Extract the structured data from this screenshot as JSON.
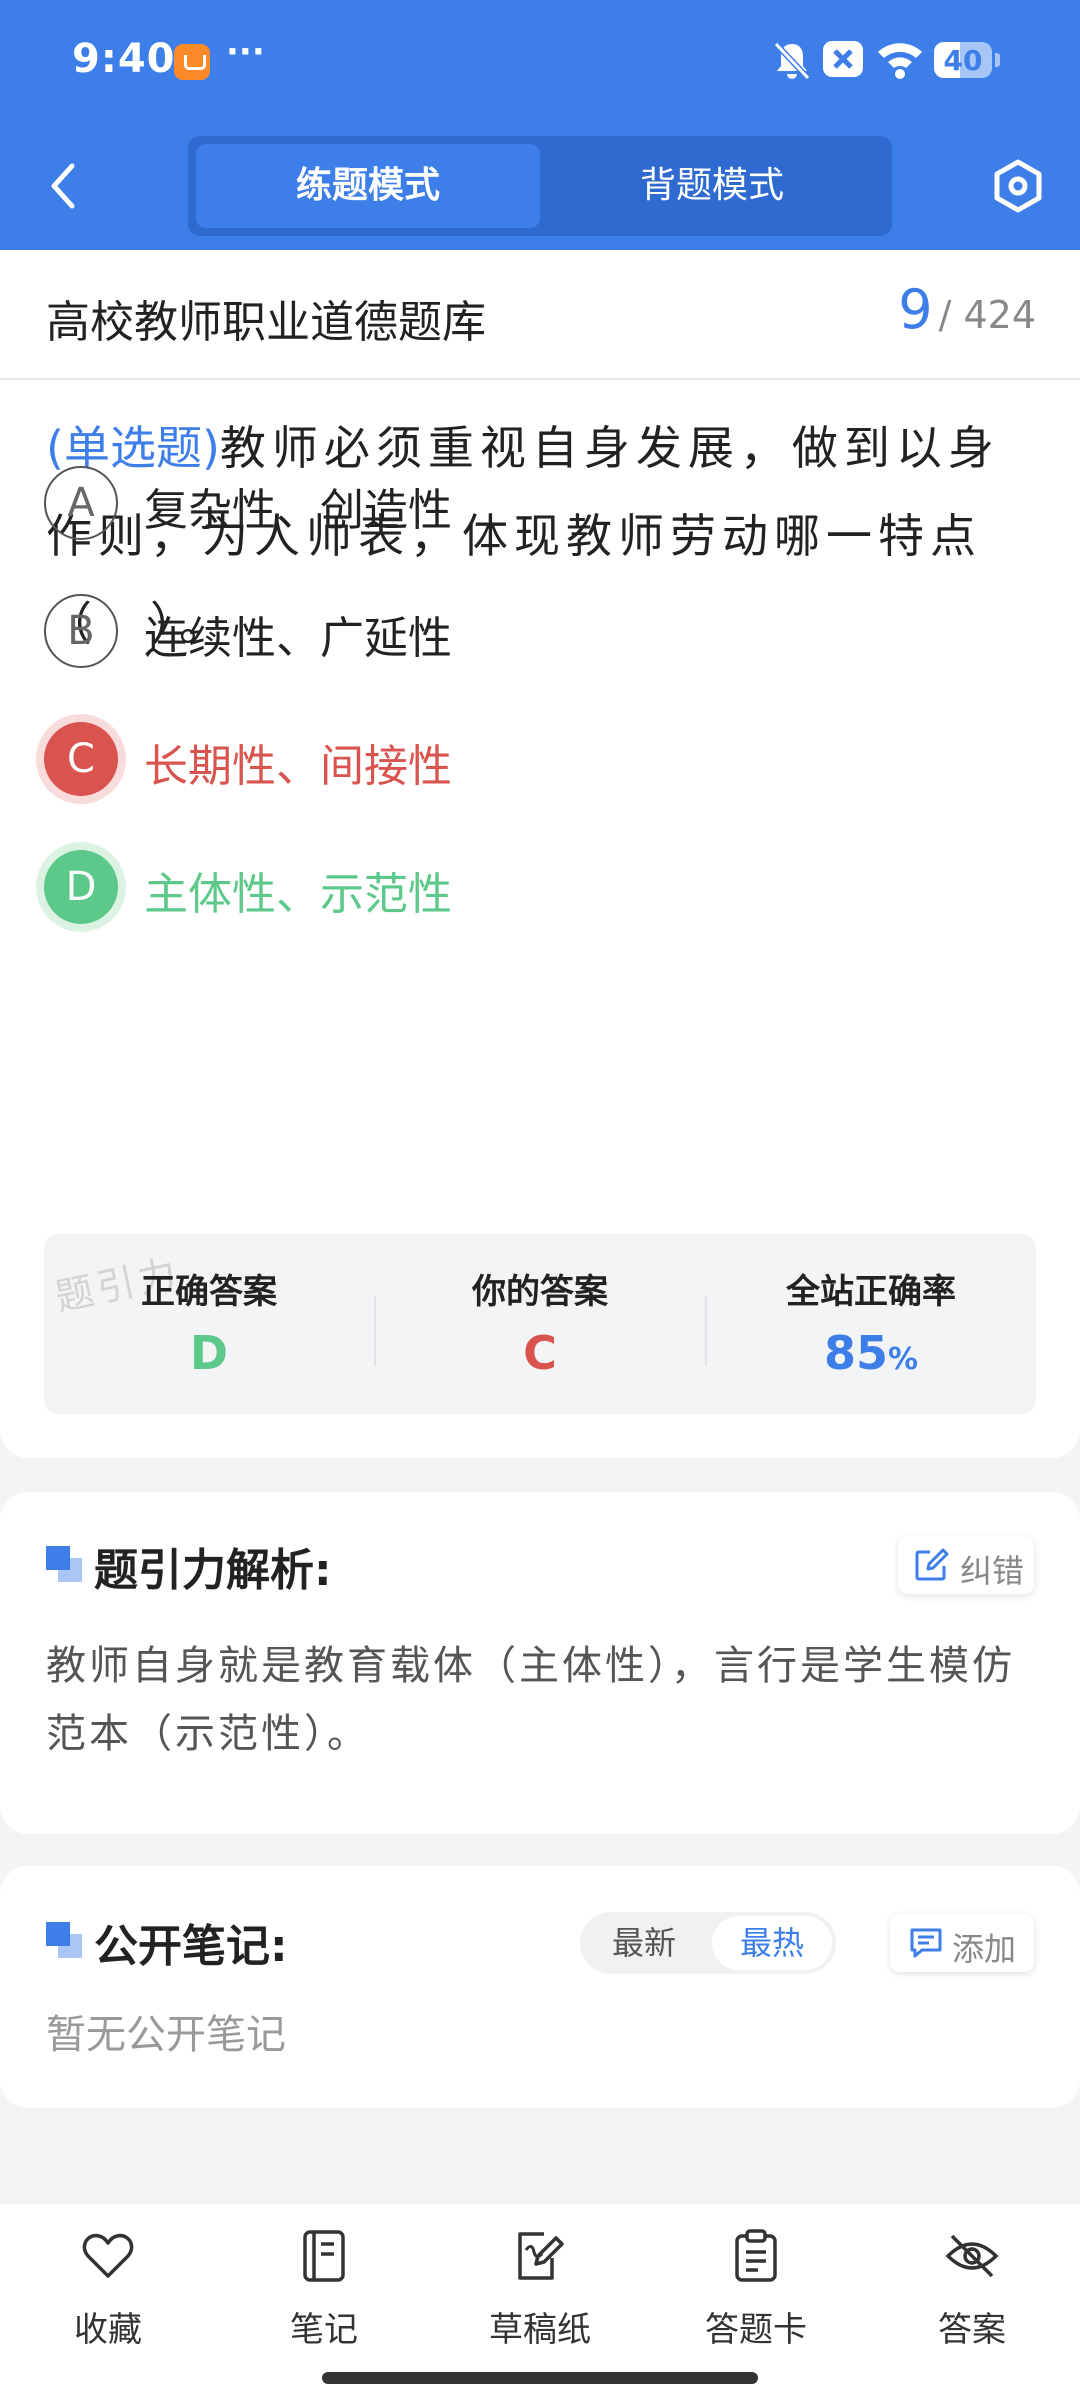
{
  "status_bar": {
    "time": "9:40",
    "more": "···",
    "battery": "40"
  },
  "header": {
    "modes": [
      "练题模式",
      "背题模式"
    ],
    "active_mode": "练题模式"
  },
  "bank": {
    "title": "高校教师职业道德题库",
    "current": "9",
    "total": "/ 424"
  },
  "question": {
    "type": "(单选题)",
    "text": "教师必须重视自身发展，做到以身作则，为人师表，体现教师劳动哪一特点（　）。",
    "options": [
      {
        "letter": "A",
        "text": "复杂性、创造性",
        "state": "normal"
      },
      {
        "letter": "B",
        "text": "连续性、广延性",
        "state": "normal"
      },
      {
        "letter": "C",
        "text": "长期性、间接性",
        "state": "wrong"
      },
      {
        "letter": "D",
        "text": "主体性、示范性",
        "state": "correct"
      }
    ]
  },
  "result": {
    "watermark": "题引力",
    "correct_label": "正确答案",
    "correct_value": "D",
    "yours_label": "你的答案",
    "yours_value": "C",
    "rate_label": "全站正确率",
    "rate_value": "85",
    "rate_unit": "%"
  },
  "analysis": {
    "title": "题引力解析:",
    "report_label": "纠错",
    "text": "教师自身就是教育载体（主体性），言行是学生模仿范本（示范性）。"
  },
  "notes": {
    "title": "公开笔记:",
    "sort_options": [
      "最新",
      "最热"
    ],
    "active_sort": "最热",
    "add_label": "添加",
    "empty_text": "暂无公开笔记"
  },
  "bottom_tabs": [
    "收藏",
    "笔记",
    "草稿纸",
    "答题卡",
    "答案"
  ],
  "colors": {
    "primary": "#3d7ee8",
    "wrong": "#d9534f",
    "correct": "#5cc98a"
  }
}
